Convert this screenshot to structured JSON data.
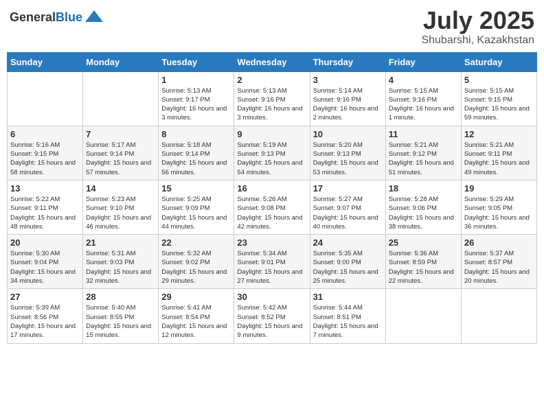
{
  "header": {
    "logo_general": "General",
    "logo_blue": "Blue",
    "month_year": "July 2025",
    "location": "Shubarshi, Kazakhstan"
  },
  "days_of_week": [
    "Sunday",
    "Monday",
    "Tuesday",
    "Wednesday",
    "Thursday",
    "Friday",
    "Saturday"
  ],
  "weeks": [
    [
      {
        "day": "",
        "sunrise": "",
        "sunset": "",
        "daylight": ""
      },
      {
        "day": "",
        "sunrise": "",
        "sunset": "",
        "daylight": ""
      },
      {
        "day": "1",
        "sunrise": "Sunrise: 5:13 AM",
        "sunset": "Sunset: 9:17 PM",
        "daylight": "Daylight: 16 hours and 3 minutes."
      },
      {
        "day": "2",
        "sunrise": "Sunrise: 5:13 AM",
        "sunset": "Sunset: 9:16 PM",
        "daylight": "Daylight: 16 hours and 3 minutes."
      },
      {
        "day": "3",
        "sunrise": "Sunrise: 5:14 AM",
        "sunset": "Sunset: 9:16 PM",
        "daylight": "Daylight: 16 hours and 2 minutes."
      },
      {
        "day": "4",
        "sunrise": "Sunrise: 5:15 AM",
        "sunset": "Sunset: 9:16 PM",
        "daylight": "Daylight: 16 hours and 1 minute."
      },
      {
        "day": "5",
        "sunrise": "Sunrise: 5:15 AM",
        "sunset": "Sunset: 9:15 PM",
        "daylight": "Daylight: 15 hours and 59 minutes."
      }
    ],
    [
      {
        "day": "6",
        "sunrise": "Sunrise: 5:16 AM",
        "sunset": "Sunset: 9:15 PM",
        "daylight": "Daylight: 15 hours and 58 minutes."
      },
      {
        "day": "7",
        "sunrise": "Sunrise: 5:17 AM",
        "sunset": "Sunset: 9:14 PM",
        "daylight": "Daylight: 15 hours and 57 minutes."
      },
      {
        "day": "8",
        "sunrise": "Sunrise: 5:18 AM",
        "sunset": "Sunset: 9:14 PM",
        "daylight": "Daylight: 15 hours and 56 minutes."
      },
      {
        "day": "9",
        "sunrise": "Sunrise: 5:19 AM",
        "sunset": "Sunset: 9:13 PM",
        "daylight": "Daylight: 15 hours and 54 minutes."
      },
      {
        "day": "10",
        "sunrise": "Sunrise: 5:20 AM",
        "sunset": "Sunset: 9:13 PM",
        "daylight": "Daylight: 15 hours and 53 minutes."
      },
      {
        "day": "11",
        "sunrise": "Sunrise: 5:21 AM",
        "sunset": "Sunset: 9:12 PM",
        "daylight": "Daylight: 15 hours and 51 minutes."
      },
      {
        "day": "12",
        "sunrise": "Sunrise: 5:21 AM",
        "sunset": "Sunset: 9:11 PM",
        "daylight": "Daylight: 15 hours and 49 minutes."
      }
    ],
    [
      {
        "day": "13",
        "sunrise": "Sunrise: 5:22 AM",
        "sunset": "Sunset: 9:11 PM",
        "daylight": "Daylight: 15 hours and 48 minutes."
      },
      {
        "day": "14",
        "sunrise": "Sunrise: 5:23 AM",
        "sunset": "Sunset: 9:10 PM",
        "daylight": "Daylight: 15 hours and 46 minutes."
      },
      {
        "day": "15",
        "sunrise": "Sunrise: 5:25 AM",
        "sunset": "Sunset: 9:09 PM",
        "daylight": "Daylight: 15 hours and 44 minutes."
      },
      {
        "day": "16",
        "sunrise": "Sunrise: 5:26 AM",
        "sunset": "Sunset: 9:08 PM",
        "daylight": "Daylight: 15 hours and 42 minutes."
      },
      {
        "day": "17",
        "sunrise": "Sunrise: 5:27 AM",
        "sunset": "Sunset: 9:07 PM",
        "daylight": "Daylight: 15 hours and 40 minutes."
      },
      {
        "day": "18",
        "sunrise": "Sunrise: 5:28 AM",
        "sunset": "Sunset: 9:06 PM",
        "daylight": "Daylight: 15 hours and 38 minutes."
      },
      {
        "day": "19",
        "sunrise": "Sunrise: 5:29 AM",
        "sunset": "Sunset: 9:05 PM",
        "daylight": "Daylight: 15 hours and 36 minutes."
      }
    ],
    [
      {
        "day": "20",
        "sunrise": "Sunrise: 5:30 AM",
        "sunset": "Sunset: 9:04 PM",
        "daylight": "Daylight: 15 hours and 34 minutes."
      },
      {
        "day": "21",
        "sunrise": "Sunrise: 5:31 AM",
        "sunset": "Sunset: 9:03 PM",
        "daylight": "Daylight: 15 hours and 32 minutes."
      },
      {
        "day": "22",
        "sunrise": "Sunrise: 5:32 AM",
        "sunset": "Sunset: 9:02 PM",
        "daylight": "Daylight: 15 hours and 29 minutes."
      },
      {
        "day": "23",
        "sunrise": "Sunrise: 5:34 AM",
        "sunset": "Sunset: 9:01 PM",
        "daylight": "Daylight: 15 hours and 27 minutes."
      },
      {
        "day": "24",
        "sunrise": "Sunrise: 5:35 AM",
        "sunset": "Sunset: 9:00 PM",
        "daylight": "Daylight: 15 hours and 25 minutes."
      },
      {
        "day": "25",
        "sunrise": "Sunrise: 5:36 AM",
        "sunset": "Sunset: 8:59 PM",
        "daylight": "Daylight: 15 hours and 22 minutes."
      },
      {
        "day": "26",
        "sunrise": "Sunrise: 5:37 AM",
        "sunset": "Sunset: 8:57 PM",
        "daylight": "Daylight: 15 hours and 20 minutes."
      }
    ],
    [
      {
        "day": "27",
        "sunrise": "Sunrise: 5:39 AM",
        "sunset": "Sunset: 8:56 PM",
        "daylight": "Daylight: 15 hours and 17 minutes."
      },
      {
        "day": "28",
        "sunrise": "Sunrise: 5:40 AM",
        "sunset": "Sunset: 8:55 PM",
        "daylight": "Daylight: 15 hours and 15 minutes."
      },
      {
        "day": "29",
        "sunrise": "Sunrise: 5:41 AM",
        "sunset": "Sunset: 8:54 PM",
        "daylight": "Daylight: 15 hours and 12 minutes."
      },
      {
        "day": "30",
        "sunrise": "Sunrise: 5:42 AM",
        "sunset": "Sunset: 8:52 PM",
        "daylight": "Daylight: 15 hours and 9 minutes."
      },
      {
        "day": "31",
        "sunrise": "Sunrise: 5:44 AM",
        "sunset": "Sunset: 8:51 PM",
        "daylight": "Daylight: 15 hours and 7 minutes."
      },
      {
        "day": "",
        "sunrise": "",
        "sunset": "",
        "daylight": ""
      },
      {
        "day": "",
        "sunrise": "",
        "sunset": "",
        "daylight": ""
      }
    ]
  ]
}
